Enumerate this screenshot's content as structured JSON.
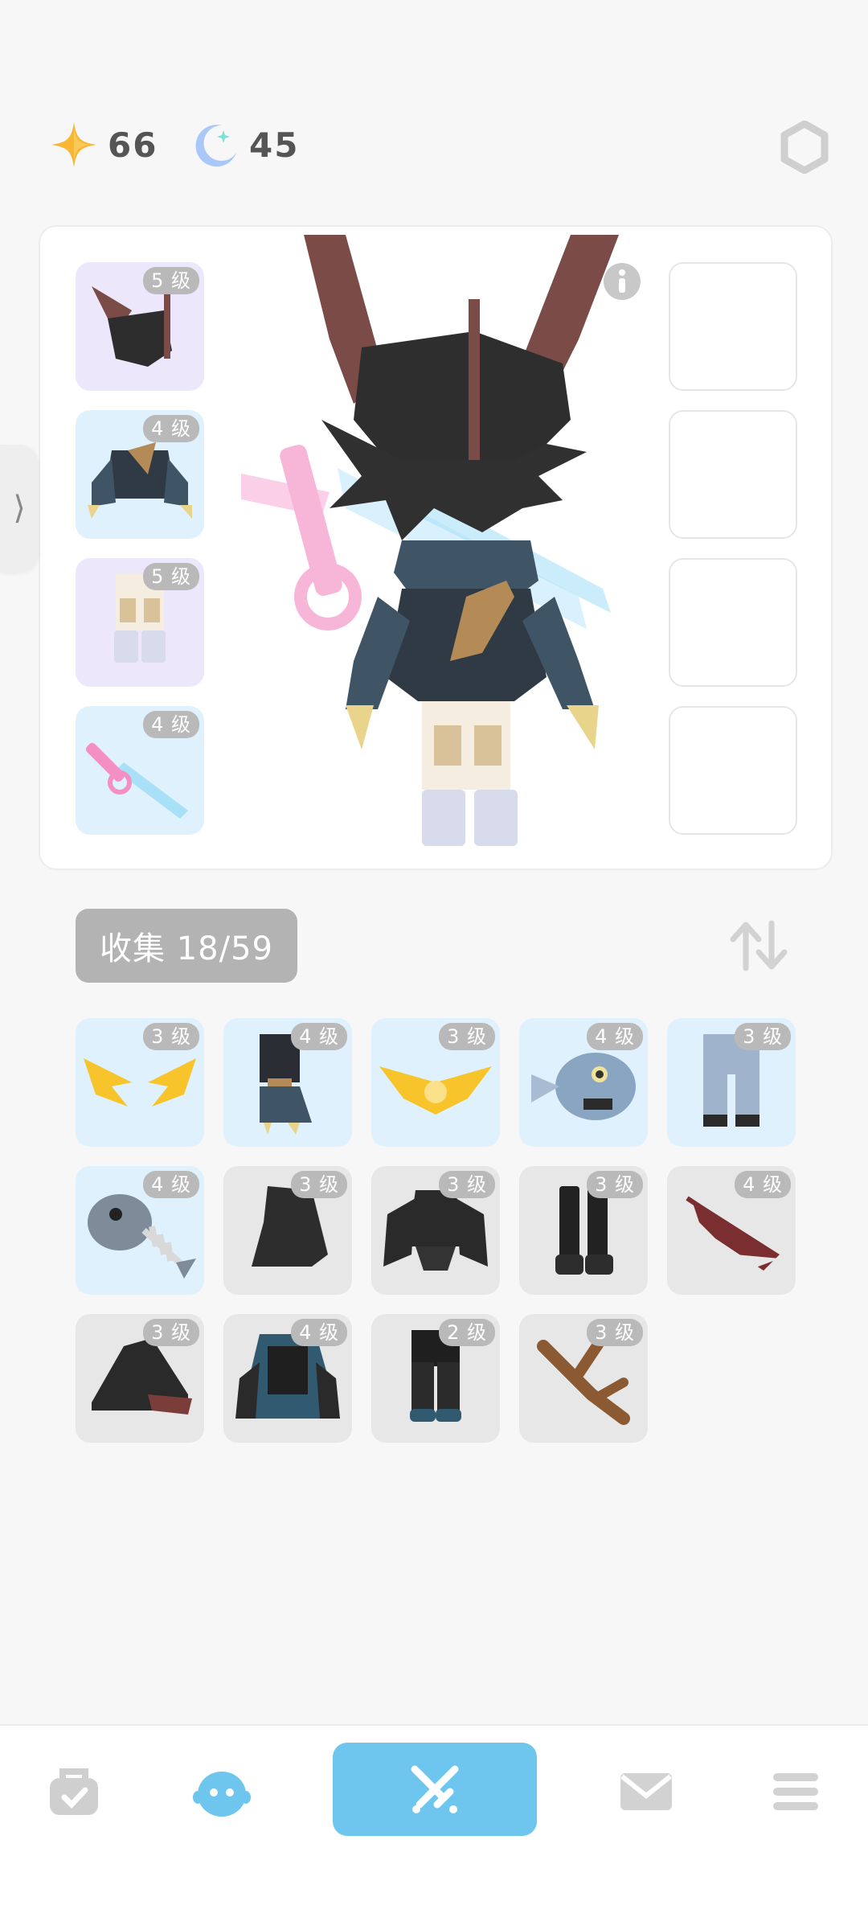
{
  "currency": {
    "star": {
      "icon": "star-icon",
      "value": "66",
      "color": "#f7b733"
    },
    "moon": {
      "icon": "moon-icon",
      "value": "45",
      "color": "#a9c8f7"
    }
  },
  "panel": {
    "equipped_left": [
      {
        "level": "5 级",
        "item": "bat-helmet",
        "rarity": "purple"
      },
      {
        "level": "4 级",
        "item": "scarf-armor",
        "rarity": "blue"
      },
      {
        "level": "5 级",
        "item": "pants",
        "rarity": "purple"
      },
      {
        "level": "4 级",
        "item": "sword",
        "rarity": "blue"
      }
    ],
    "equipped_right": [
      {
        "item": "empty"
      },
      {
        "item": "empty"
      },
      {
        "item": "empty"
      },
      {
        "item": "empty"
      }
    ]
  },
  "collection": {
    "label": "收集 18/59",
    "items": [
      {
        "level": "3 级",
        "item": "golden-wings",
        "rarity": "blue"
      },
      {
        "level": "4 级",
        "item": "dark-boots",
        "rarity": "blue"
      },
      {
        "level": "3 级",
        "item": "golden-crown-wings",
        "rarity": "blue"
      },
      {
        "level": "4 级",
        "item": "fish-head",
        "rarity": "blue"
      },
      {
        "level": "3 级",
        "item": "blue-pants",
        "rarity": "blue"
      },
      {
        "level": "4 级",
        "item": "fish-skeleton",
        "rarity": "blue"
      },
      {
        "level": "3 级",
        "item": "dark-hood",
        "rarity": "gray"
      },
      {
        "level": "3 级",
        "item": "dark-armor",
        "rarity": "gray"
      },
      {
        "level": "3 级",
        "item": "black-boots",
        "rarity": "gray"
      },
      {
        "level": "4 级",
        "item": "red-blade",
        "rarity": "gray"
      },
      {
        "level": "3 级",
        "item": "witch-hat",
        "rarity": "gray"
      },
      {
        "level": "4 级",
        "item": "blue-cloak",
        "rarity": "gray"
      },
      {
        "level": "2 级",
        "item": "black-pants",
        "rarity": "gray"
      },
      {
        "level": "3 级",
        "item": "wooden-branch",
        "rarity": "gray"
      }
    ]
  },
  "nav": {
    "items": [
      "bag-icon",
      "character-icon",
      "battle-icon",
      "mail-icon",
      "menu-icon"
    ],
    "accent": "#6ec5ee"
  }
}
